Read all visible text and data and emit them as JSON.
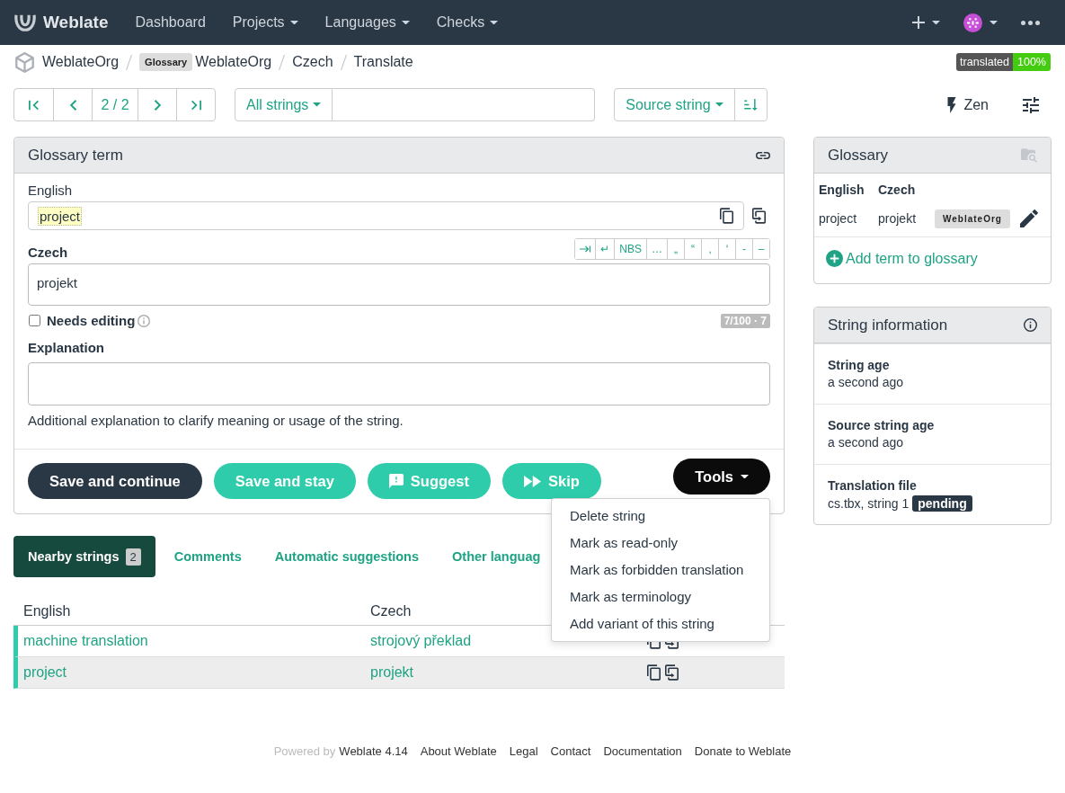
{
  "navbar": {
    "brand": "Weblate",
    "menu": [
      {
        "label": "Dashboard",
        "dropdown": false
      },
      {
        "label": "Projects",
        "dropdown": true
      },
      {
        "label": "Languages",
        "dropdown": true
      },
      {
        "label": "Checks",
        "dropdown": true
      }
    ]
  },
  "breadcrumb": [
    {
      "label": "WeblateOrg"
    },
    {
      "badge": "Glossary",
      "label": "WeblateOrg"
    },
    {
      "label": "Czech"
    },
    {
      "label": "Translate"
    }
  ],
  "progress_badge": {
    "label": "translated",
    "value": "100%"
  },
  "toolbar": {
    "position": "2 / 2",
    "filter": "All strings",
    "sort": "Source string",
    "zen": "Zen"
  },
  "editor": {
    "title": "Glossary term",
    "source": {
      "label": "English",
      "text": "project",
      "highlighted": true
    },
    "target": {
      "label": "Czech",
      "text": "projekt"
    },
    "special_chars": [
      "↵",
      "NBS",
      "…",
      "„",
      "“",
      "‚",
      "‘",
      "-",
      "–"
    ],
    "needs_editing": {
      "label": "Needs editing",
      "checked": false
    },
    "counter": "7/100 · 7",
    "explanation": {
      "label": "Explanation",
      "help": "Additional explanation to clarify meaning or usage of the string."
    },
    "buttons": [
      {
        "label": "Save and continue",
        "kind": "primary"
      },
      {
        "label": "Save and stay",
        "kind": "secondary"
      },
      {
        "label": "Suggest",
        "kind": "suggest"
      },
      {
        "label": "Skip",
        "kind": "skip"
      }
    ],
    "tools": {
      "label": "Tools",
      "expanded": true,
      "items": [
        "Delete string",
        "Mark as read-only",
        "Mark as forbidden translation",
        "Mark as terminology",
        "Add variant of this string"
      ]
    }
  },
  "nearby": {
    "tabs": [
      {
        "label": "Nearby strings",
        "count": "2",
        "selected": true
      },
      {
        "label": "Comments",
        "selected": false
      },
      {
        "label": "Automatic suggestions",
        "selected": false
      },
      {
        "label": "Other languag",
        "selected": false
      }
    ],
    "columns": [
      "English",
      "Czech"
    ],
    "rows": [
      {
        "source": "machine translation",
        "target": "strojový překlad",
        "selected": false
      },
      {
        "source": "project",
        "target": "projekt",
        "selected": true
      }
    ]
  },
  "glossary": {
    "title": "Glossary",
    "columns": [
      "English",
      "Czech"
    ],
    "terms": [
      {
        "source": "project",
        "target": "projekt",
        "badge": "WeblateOrg"
      }
    ],
    "add": "Add term to glossary"
  },
  "string_info": {
    "title": "String information",
    "items": [
      {
        "label": "String age",
        "value": "a second ago"
      },
      {
        "label": "Source string age",
        "value": "a second ago"
      },
      {
        "label": "Translation file",
        "value": "cs.tbx, string 1",
        "badge": "pending"
      }
    ]
  },
  "footer": {
    "powered_by": "Powered by",
    "version": "Weblate 4.14",
    "links": [
      "About Weblate",
      "Legal",
      "Contact",
      "Documentation",
      "Donate to Weblate"
    ]
  }
}
